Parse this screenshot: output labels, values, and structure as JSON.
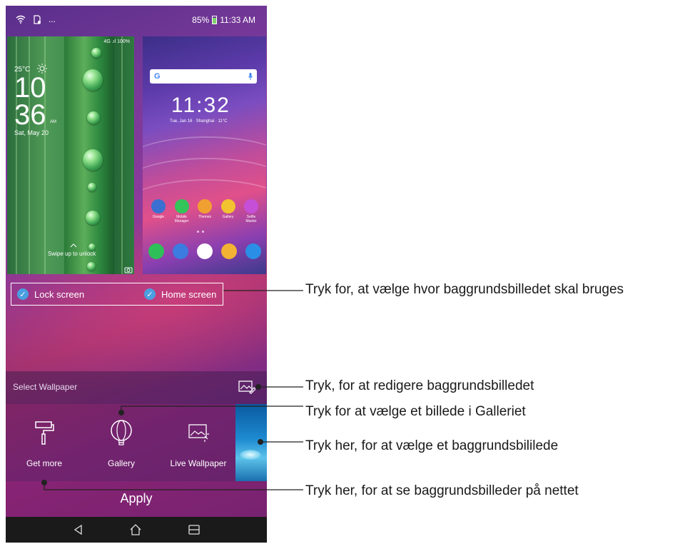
{
  "status_bar": {
    "overflow": "...",
    "battery": "85%",
    "time": "11:33 AM"
  },
  "lock_preview": {
    "status": "4G .ıl 100%",
    "temperature": "25°C",
    "hour": "10",
    "minute": "36",
    "ampm": "AM",
    "date": "Sat, May 20",
    "swipe_hint": "Swipe up to unlock"
  },
  "home_preview": {
    "search_logo": "G",
    "clock": "11:32",
    "date": "Tue, Jan 16 · Shanghai · 11°C",
    "apps": [
      {
        "label": "Google",
        "color": "#3b6fd1"
      },
      {
        "label": "Mobile Manager",
        "color": "#33c45a"
      },
      {
        "label": "Themes",
        "color": "#f0a030"
      },
      {
        "label": "Gallery",
        "color": "#f2c230"
      },
      {
        "label": "Selfie Master",
        "color": "#c64fd8"
      }
    ],
    "dock": [
      {
        "name": "phone",
        "color": "#2fbf58"
      },
      {
        "name": "messages",
        "color": "#3c7be0"
      },
      {
        "name": "play-store",
        "color": "#ffffff"
      },
      {
        "name": "chrome",
        "color": "#f2b233"
      },
      {
        "name": "camera",
        "color": "#2a8ee6"
      }
    ]
  },
  "targets": {
    "lock_screen": "Lock screen",
    "home_screen": "Home screen"
  },
  "select_wallpaper": {
    "label": "Select Wallpaper"
  },
  "options": {
    "get_more": "Get more",
    "gallery": "Gallery",
    "live_wallpaper": "Live Wallpaper"
  },
  "apply": "Apply",
  "callouts": {
    "select_target": "Tryk for, at vælge hvor baggrundsbilledet skal bruges",
    "edit": "Tryk, for at redigere baggrundsbilledet",
    "gallery": "Tryk for at vælge et billede i Galleriet",
    "wallpaper": "Tryk her, for at vælge et baggrundsbililede",
    "online": "Tryk her, for at se baggrundsbilleder på nettet"
  },
  "colors": {
    "checkbox": "#4a9fe0",
    "navbar": "#1a1a1a"
  }
}
